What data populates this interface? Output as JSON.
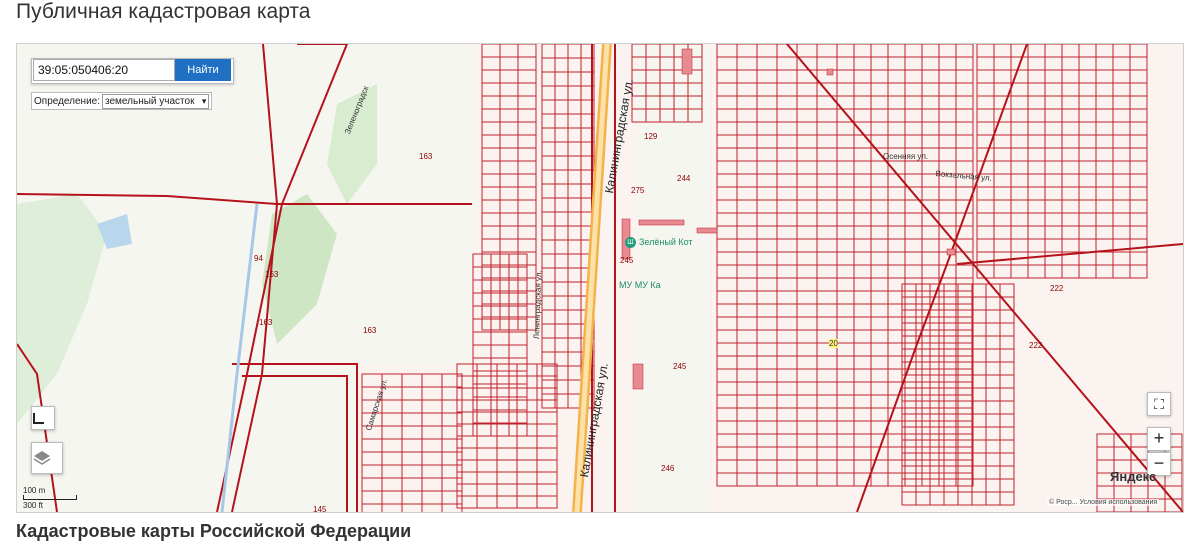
{
  "page_title": "Публичная кадастровая карта",
  "section_title": "Кадастровые карты Российской Федерации",
  "search": {
    "value": "39:05:050406:20",
    "button_label": "Найти"
  },
  "definition": {
    "label": "Определение:",
    "selected": "земельный участок"
  },
  "map": {
    "streets": {
      "kaliningradskaya_top": "Калининградская ул.",
      "kaliningradskaya_bottom": "Калининградская ул.",
      "leningradskaya": "Ленинградская ул.",
      "zelenogradsk": "Зеленоградск",
      "samarskaya": "Самарская ул.",
      "vokzalnaya": "Вокзальная ул.",
      "osennyaya": "Осенняя ул."
    },
    "pois": {
      "zeleny_kot": "Зелёный Кот",
      "mu_ka": "МУ МУ Ка"
    },
    "parcel_labels": {
      "p163a": "163",
      "p163b": "163",
      "p163c": "163",
      "p163d": "163",
      "p94": "94",
      "p244": "244",
      "p245a": "245",
      "p245b": "245",
      "p246": "246",
      "p222a": "222",
      "p222b": "222",
      "p275": "275",
      "p129": "129",
      "p20": "20",
      "p145": "145"
    },
    "scale": {
      "metric": "100 m",
      "imperial": "300 ft"
    },
    "logo": "Яндекс",
    "copyright": "© Роср... Условия использования"
  },
  "icons": {
    "ruler": "ruler-icon",
    "layers": "layers-icon",
    "fullscreen": "fullscreen-icon",
    "zoom_in": "plus-icon",
    "zoom_out": "minus-icon"
  },
  "controls": {
    "zoom_in": "+",
    "zoom_out": "−",
    "fullscreen": "⛶"
  }
}
